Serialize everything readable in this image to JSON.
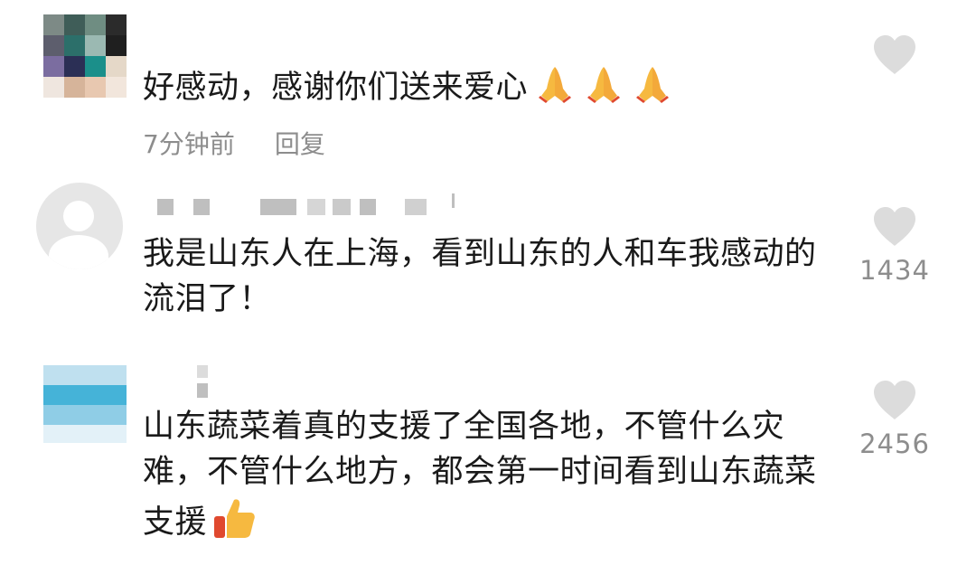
{
  "comments": [
    {
      "text": "好感动，感谢你们送来爱心",
      "emoji": [
        "folded-hands-icon",
        "folded-hands-icon",
        "folded-hands-icon"
      ],
      "time": "7分钟前",
      "reply_label": "回复",
      "likes": ""
    },
    {
      "text": "我是山东人在上海，看到山东的人和车我感动的流泪了！",
      "likes": "1434"
    },
    {
      "text": "山东蔬菜着真的支援了全国各地，不管什么灾难，不管什么地方，都会第一时间看到山东蔬菜支援",
      "emoji": [
        "thumbs-up-icon"
      ],
      "likes": "2456"
    }
  ],
  "colors": {
    "text": "#1a1a1a",
    "meta": "#8d8d8d",
    "heart": "#dcdcdc"
  }
}
